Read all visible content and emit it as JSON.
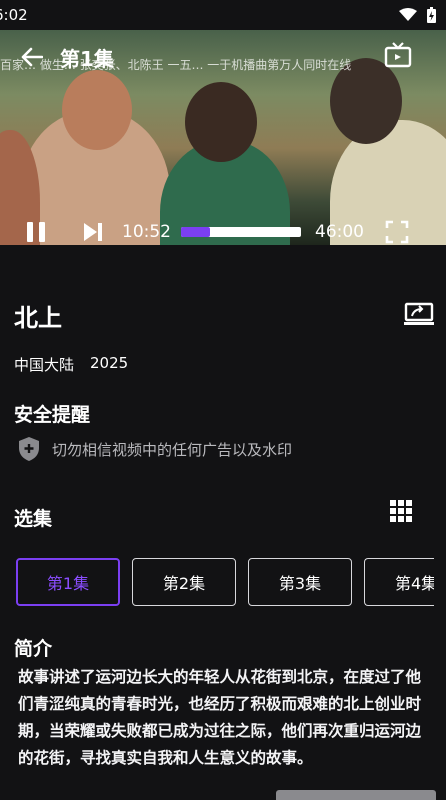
{
  "status": {
    "time": "6:02"
  },
  "player": {
    "episode_title": "第1集",
    "danmaku": "百家…  做生…  张奕张、北陈王  一五… 一于机播曲第万人同时在线",
    "current_time": "10:52",
    "total_time": "46:00",
    "progress": 0.24,
    "accent": "#7b3ff2"
  },
  "show": {
    "title": "北上",
    "region": "中国大陆",
    "year": "2025"
  },
  "safety": {
    "heading": "安全提醒",
    "text": "切勿相信视频中的任何广告以及水印"
  },
  "episodes": {
    "heading": "选集",
    "items": [
      "第1集",
      "第2集",
      "第3集",
      "第4集"
    ]
  },
  "synopsis": {
    "heading": "简介",
    "text": "故事讲述了运河边长大的年轻人从花街到北京，在度过了他们青涩纯真的青春时光，也经历了积极而艰难的北上创业时期，当荣耀或失败都已成为过往之际，他们再次重归运河边的花街，寻找真实自我和人生意义的故事。"
  },
  "icons": [
    "back-arrow-icon",
    "tv-cast-icon",
    "pause-icon",
    "skip-next-icon",
    "fullscreen-icon",
    "screen-share-icon",
    "shield-icon",
    "grid-icon",
    "wifi-icon",
    "battery-icon"
  ]
}
